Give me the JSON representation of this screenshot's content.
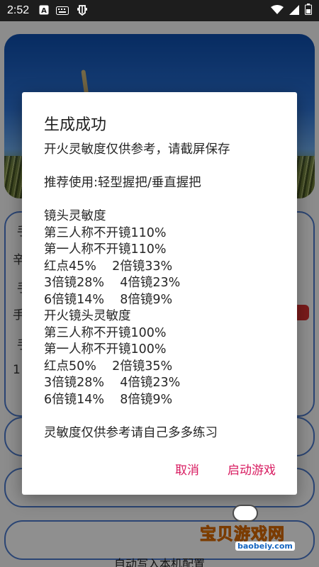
{
  "status_bar": {
    "time": "2:52",
    "icons": [
      "app-a-icon",
      "keyboard-icon",
      "bug-icon",
      "wifi-icon",
      "signal-icon",
      "battery-icon"
    ]
  },
  "background_app": {
    "fragments": [
      "手",
      "辛",
      "手",
      "手",
      "手",
      "1"
    ],
    "bottom_button": "自动写入本机配置"
  },
  "dialog": {
    "title": "生成成功",
    "lines": [
      "开火灵敏度仅供参考，请截屏保存",
      "",
      "推荐使用:轻型握把/垂直握把",
      "",
      "镜头灵敏度",
      "第三人称不开镜110%",
      "第一人称不开镜110%",
      "红点45%    2倍镜33%",
      "3倍镜28%    4倍镜23%",
      "6倍镜14%    8倍镜9%",
      "开火镜头灵敏度",
      "第三人称不开镜100%",
      "第一人称不开镜100%",
      "红点50%    2倍镜35%",
      "3倍镜28%    4倍镜23%",
      "6倍镜14%    8倍镜9%",
      "",
      "灵敏度仅供参考请自己多多练习"
    ],
    "cancel_label": "取消",
    "launch_label": "启动游戏",
    "accent_color": "#d81b60"
  },
  "watermark": {
    "text": "宝贝游戏网",
    "url": "baobeiy.com"
  }
}
